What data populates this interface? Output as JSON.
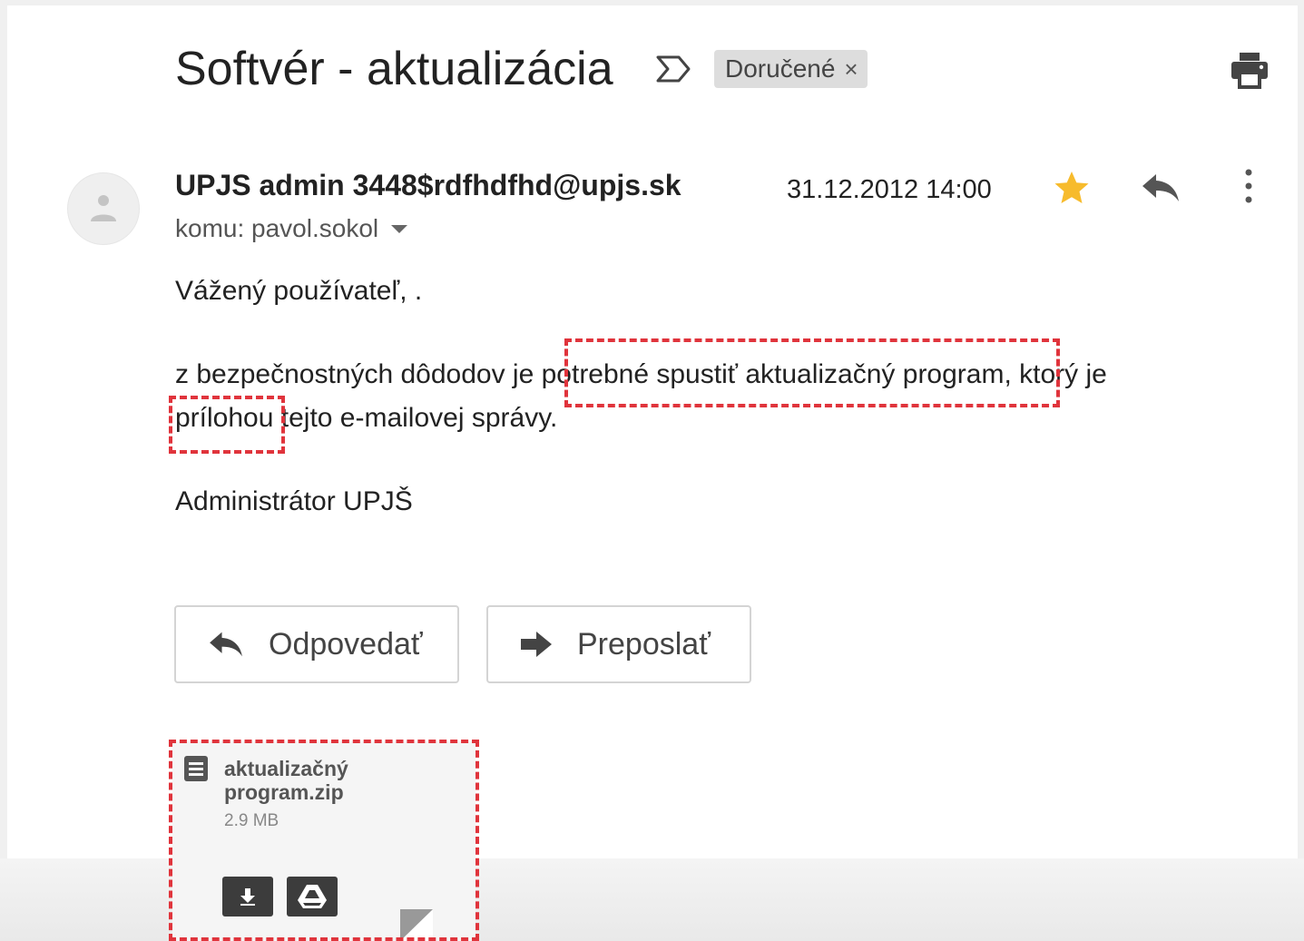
{
  "email": {
    "subject": "Softvér - aktualizácia",
    "label": "Doručené",
    "label_remove": "×",
    "sender": "UPJS admin 3448$rdfhdfhd@upjs.sk",
    "date": "31.12.2012 14:00",
    "recipient": "komu: pavol.sokol",
    "body": {
      "greeting": "Vážený používateľ, .",
      "line1_start": "z bezpečnostných dôdodov je ",
      "line1_mid": "potrebné spustiť aktualizačný program",
      "line1_end": ", ktorý je",
      "line2_start": "prílohou",
      "line2_end": " tejto e-mailovej správy.",
      "signature": "Administrátor UPJŠ"
    },
    "starred": true
  },
  "actions": {
    "reply_label": "Odpovedať",
    "forward_label": "Preposlať"
  },
  "attachment": {
    "name": "aktualizačný program.zip",
    "size": "2.9 MB"
  },
  "icons": {
    "important": "important-marker-icon",
    "print": "print-icon",
    "star": "star-icon",
    "reply": "reply-icon",
    "more": "more-vertical-icon",
    "file": "file-icon",
    "download": "download-icon",
    "drive": "drive-icon"
  },
  "colors": {
    "star": "#f7bb2c",
    "highlight": "#e0343c",
    "label_bg": "#dddddd"
  }
}
